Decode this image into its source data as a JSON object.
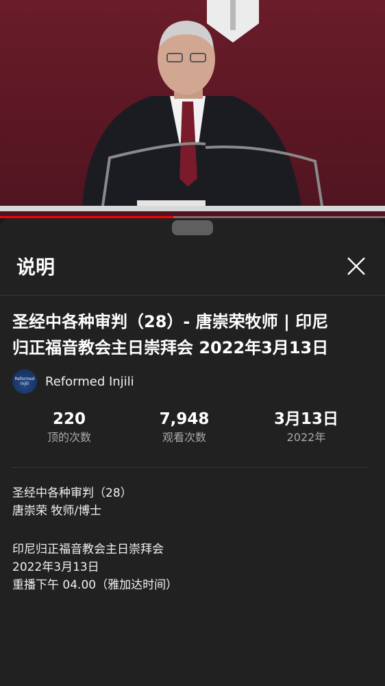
{
  "video": {
    "progress": 0.45
  },
  "sheet": {
    "title": "说明",
    "close_icon": "close-icon"
  },
  "video_info": {
    "title_line1": "圣经中各种审判（28）- 唐崇荣牧师 | 印尼",
    "title_line2": "归正福音教会主日崇拜会 2022年3月13日",
    "channel": {
      "name": "Reformed Injili",
      "avatar_text_1": "Reformed",
      "avatar_text_2": "Injili"
    },
    "stats": [
      {
        "value": "220",
        "label": "顶的次数"
      },
      {
        "value": "7,948",
        "label": "观看次数"
      },
      {
        "value": "3月13日",
        "label": "2022年"
      }
    ]
  },
  "description": {
    "lines_1": [
      "圣经中各种审判（28）",
      "唐崇荣 牧师/博士"
    ],
    "lines_2": [
      "印尼归正福音教会主日崇拜会",
      "2022年3月13日",
      "重播下午 04.00（雅加达时间）"
    ]
  },
  "colors": {
    "background": "#212121",
    "accent": "#ff0000",
    "video_backdrop": "#5a1723"
  }
}
